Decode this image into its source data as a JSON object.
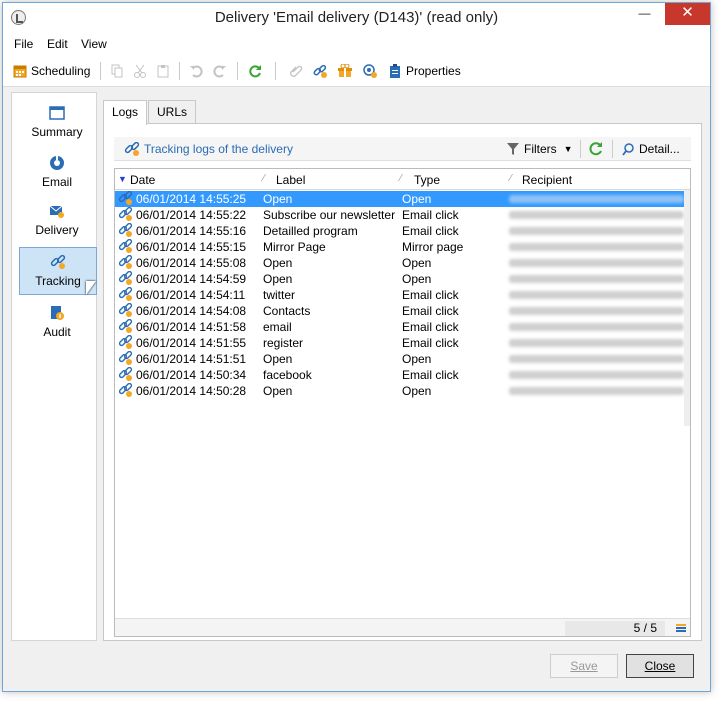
{
  "window": {
    "title": "Delivery 'Email delivery (D143)' (read only)"
  },
  "window_controls": {
    "minimize": "—",
    "maximize": "☐",
    "close": "✕"
  },
  "menubar": {
    "items": [
      "File",
      "Edit",
      "View"
    ]
  },
  "toolbar": {
    "scheduling_label": "Scheduling",
    "properties_label": "Properties",
    "icons": [
      "calendar-icon",
      "copy-icon",
      "cut-icon",
      "paste-icon",
      "undo-icon",
      "redo-icon",
      "refresh-icon",
      "attachment-icon",
      "link-icon",
      "gift-icon",
      "target-icon",
      "properties-icon"
    ]
  },
  "sidebar": {
    "items": [
      {
        "label": "Summary",
        "icon": "summary-icon"
      },
      {
        "label": "Email",
        "icon": "email-icon"
      },
      {
        "label": "Delivery",
        "icon": "delivery-icon"
      },
      {
        "label": "Tracking",
        "icon": "tracking-icon",
        "active": true
      },
      {
        "label": "Audit",
        "icon": "audit-icon"
      }
    ]
  },
  "tabs": [
    {
      "label": "Logs",
      "active": true
    },
    {
      "label": "URLs",
      "active": false
    }
  ],
  "logs": {
    "title": "Tracking logs of the delivery",
    "filters_label": "Filters",
    "detail_label": "Detail...",
    "columns": [
      "Date",
      "Label",
      "Type",
      "Recipient"
    ],
    "rows": [
      {
        "date": "06/01/2014 14:55:25",
        "label": "Open",
        "type": "Open",
        "selected": true
      },
      {
        "date": "06/01/2014 14:55:22",
        "label": "Subscribe our newsletter",
        "type": "Email click"
      },
      {
        "date": "06/01/2014 14:55:16",
        "label": "Detailled program",
        "type": "Email click"
      },
      {
        "date": "06/01/2014 14:55:15",
        "label": "Mirror Page",
        "type": "Mirror page"
      },
      {
        "date": "06/01/2014 14:55:08",
        "label": "Open",
        "type": "Open"
      },
      {
        "date": "06/01/2014 14:54:59",
        "label": "Open",
        "type": "Open"
      },
      {
        "date": "06/01/2014 14:54:11",
        "label": "twitter",
        "type": "Email click"
      },
      {
        "date": "06/01/2014 14:54:08",
        "label": "Contacts",
        "type": "Email click"
      },
      {
        "date": "06/01/2014 14:51:58",
        "label": "email",
        "type": "Email click"
      },
      {
        "date": "06/01/2014 14:51:55",
        "label": "register",
        "type": "Email click"
      },
      {
        "date": "06/01/2014 14:51:51",
        "label": "Open",
        "type": "Open"
      },
      {
        "date": "06/01/2014 14:50:34",
        "label": "facebook",
        "type": "Email click"
      },
      {
        "date": "06/01/2014 14:50:28",
        "label": "Open",
        "type": "Open"
      }
    ],
    "counter": "5 / 5"
  },
  "buttons": {
    "save": "Save",
    "close": "Close"
  },
  "colors": {
    "selection": "#3399ff",
    "link": "#2a6cb6",
    "accent": "#f5a623",
    "close": "#c7372c"
  }
}
